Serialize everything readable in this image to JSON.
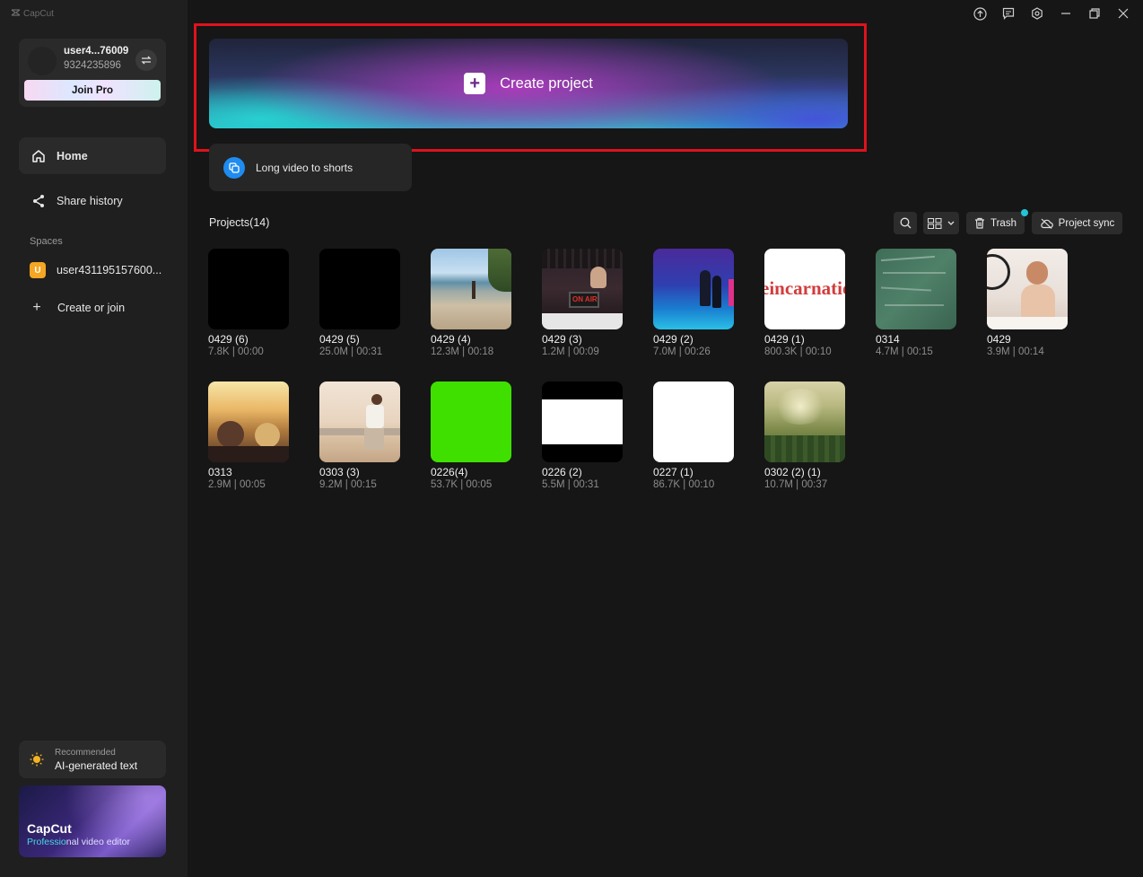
{
  "app": {
    "logo_text": "CapCut"
  },
  "user": {
    "name": "user4...76009",
    "id": "9324235896",
    "join_pro": "Join Pro"
  },
  "nav": [
    {
      "label": "Home",
      "icon": "home-icon"
    },
    {
      "label": "Share history",
      "icon": "share-icon"
    }
  ],
  "spaces": {
    "title": "Spaces",
    "item": {
      "badge": "U",
      "label": "user431195157600..."
    },
    "create_join": "Create or join"
  },
  "recommended": {
    "small": "Recommended",
    "main": "AI-generated text"
  },
  "promo": {
    "title": "CapCut",
    "sub_highlight": "Professio",
    "sub_rest": "nal video editor"
  },
  "main": {
    "create_project": "Create project",
    "long_video": "Long video to shorts",
    "projects_title": "Projects(14)",
    "trash": "Trash",
    "project_sync": "Project sync"
  },
  "projects": [
    {
      "name": "0429 (6)",
      "meta": "7.8K | 00:00",
      "thumb": "black"
    },
    {
      "name": "0429 (5)",
      "meta": "25.0M | 00:31",
      "thumb": "black"
    },
    {
      "name": "0429 (4)",
      "meta": "12.3M | 00:18",
      "thumb": "beach"
    },
    {
      "name": "0429 (3)",
      "meta": "1.2M | 00:09",
      "thumb": "studio"
    },
    {
      "name": "0429 (2)",
      "meta": "7.0M | 00:26",
      "thumb": "neon"
    },
    {
      "name": "0429 (1)",
      "meta": "800.3K | 00:10",
      "thumb": "text",
      "thumb_text": "eincarnatio"
    },
    {
      "name": "0314",
      "meta": "4.7M | 00:15",
      "thumb": "chalkboard"
    },
    {
      "name": "0429",
      "meta": "3.9M | 00:14",
      "thumb": "room"
    },
    {
      "name": "0313",
      "meta": "2.9M | 00:05",
      "thumb": "sunset-car"
    },
    {
      "name": "0303 (3)",
      "meta": "9.2M | 00:15",
      "thumb": "sea-man"
    },
    {
      "name": "0226(4)",
      "meta": "53.7K | 00:05",
      "thumb": "green"
    },
    {
      "name": "0226 (2)",
      "meta": "5.5M | 00:31",
      "thumb": "bars"
    },
    {
      "name": "0227 (1)",
      "meta": "86.7K | 00:10",
      "thumb": "white"
    },
    {
      "name": "0302 (2) (1)",
      "meta": "10.7M | 00:37",
      "thumb": "forest"
    }
  ],
  "colors": {
    "background": "#161616",
    "sidebar": "#1f1f1f",
    "highlight_frame": "#e0121c",
    "accent_cyan": "#22c4d6"
  }
}
